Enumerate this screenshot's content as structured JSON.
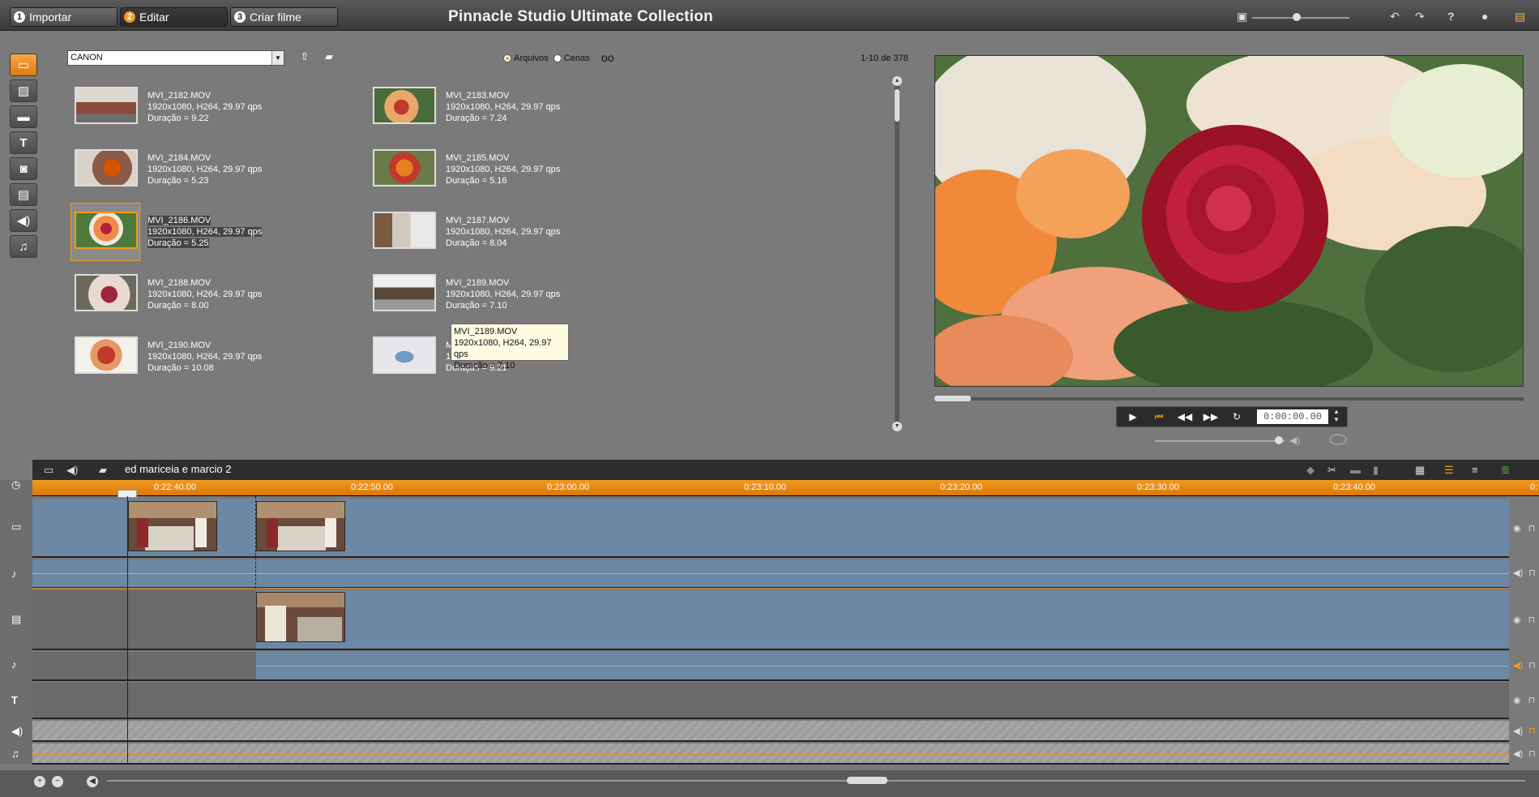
{
  "topbar": {
    "tabs": [
      {
        "num": "1",
        "label": "Importar"
      },
      {
        "num": "2",
        "label": "Editar"
      },
      {
        "num": "3",
        "label": "Criar filme"
      }
    ],
    "app_title": "Pinnacle Studio Ultimate Collection",
    "icons": [
      "screen-icon",
      "undo-icon",
      "redo-icon",
      "help-icon",
      "lightbulb-icon",
      "tray-icon"
    ]
  },
  "library": {
    "folder": "CANON",
    "radio_files": "Arquivos",
    "radio_scenes": "Cenas",
    "count": "1-10 de 378",
    "clips": [
      {
        "name": "MVI_2182.MOV",
        "info": "1920x1080, H264, 29.97 qps",
        "duration": "Duração = 9.22"
      },
      {
        "name": "MVI_2183.MOV",
        "info": "1920x1080, H264, 29.97 qps",
        "duration": "Duração = 7.24"
      },
      {
        "name": "MVI_2184.MOV",
        "info": "1920x1080, H264, 29.97 qps",
        "duration": "Duração = 5.23"
      },
      {
        "name": "MVI_2185.MOV",
        "info": "1920x1080, H264, 29.97 qps",
        "duration": "Duração = 5.16"
      },
      {
        "name": "MVI_2186.MOV",
        "info": "1920x1080, H264, 29.97 qps",
        "duration": "Duração = 5.25"
      },
      {
        "name": "MVI_2187.MOV",
        "info": "1920x1080, H264, 29.97 qps",
        "duration": "Duração = 8.04"
      },
      {
        "name": "MVI_2188.MOV",
        "info": "1920x1080, H264, 29.97 qps",
        "duration": "Duração = 8.00"
      },
      {
        "name": "MVI_2189.MOV",
        "info": "1920x1080, H264, 29.97 qps",
        "duration": "Duração = 7.10"
      },
      {
        "name": "MVI_2190.MOV",
        "info": "1920x1080, H264, 29.97 qps",
        "duration": "Duração = 10.08"
      },
      {
        "name": "M",
        "info": "1",
        "duration": "Duração = 9.21"
      }
    ],
    "tooltip": {
      "name": "MVI_2189.MOV",
      "info": "1920x1080, H264, 29.97 qps",
      "duration": "Duração = 7.10"
    }
  },
  "player": {
    "timecode": "0:00:00.00"
  },
  "timeline": {
    "project_name": "ed mariceia e marcio 2",
    "ruler": [
      "0:22:40.00",
      "0:22:50.00",
      "0:23:00.00",
      "0:23:10.00",
      "0:23:20.00",
      "0:23:30.00",
      "0:23:40.00",
      "0:"
    ]
  }
}
